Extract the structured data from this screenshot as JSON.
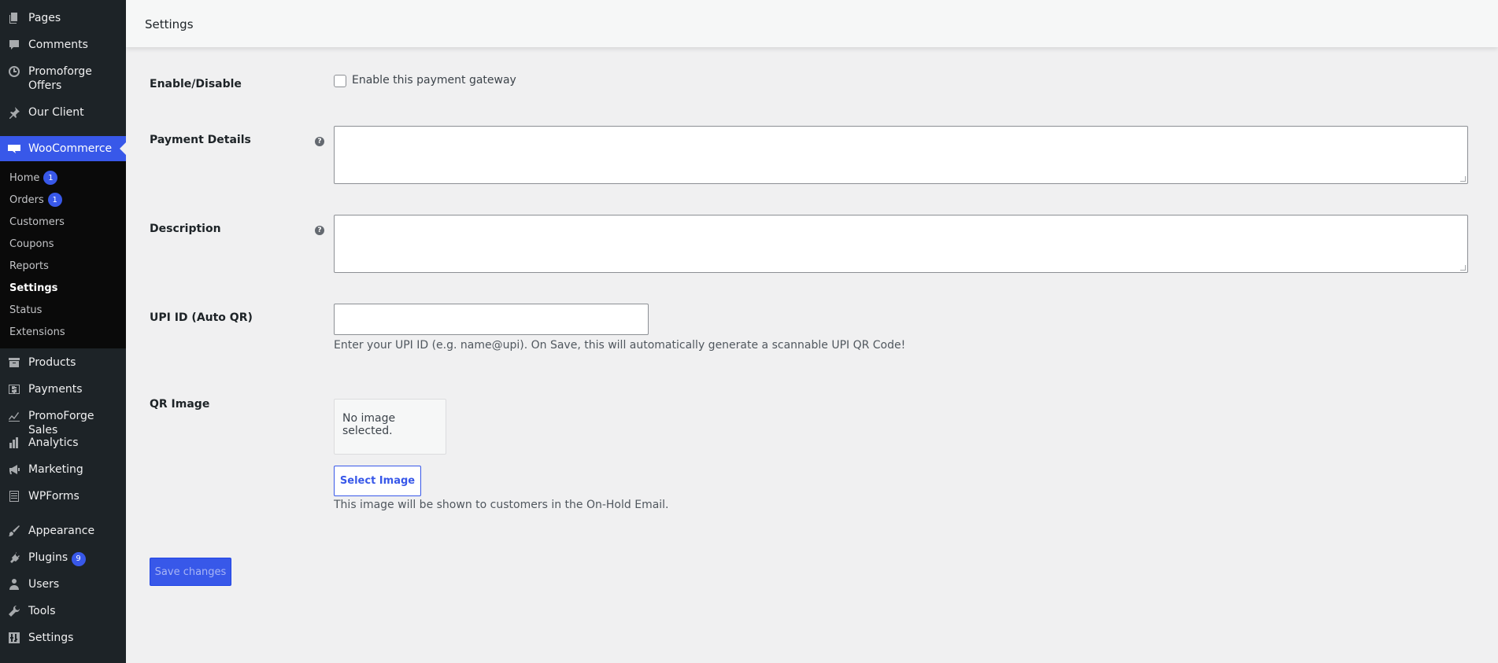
{
  "sidebar": {
    "items_top": [
      {
        "label": "Pages",
        "icon": "pages-icon"
      },
      {
        "label": "Comments",
        "icon": "comments-icon"
      },
      {
        "label": "Promoforge Offers",
        "icon": "clock-icon"
      },
      {
        "label": "Our Client",
        "icon": "pin-icon"
      }
    ],
    "woocommerce": "WooCommerce",
    "submenu": [
      {
        "label": "Home",
        "badge": "1"
      },
      {
        "label": "Orders",
        "badge": "1"
      },
      {
        "label": "Customers"
      },
      {
        "label": "Coupons"
      },
      {
        "label": "Reports"
      },
      {
        "label": "Settings"
      },
      {
        "label": "Status"
      },
      {
        "label": "Extensions"
      }
    ],
    "items_bottom": [
      {
        "label": "Products"
      },
      {
        "label": "Payments"
      },
      {
        "label": "PromoForge Sales"
      },
      {
        "label": "Analytics"
      },
      {
        "label": "Marketing"
      },
      {
        "label": "WPForms"
      },
      {
        "label": "Appearance"
      },
      {
        "label": "Plugins",
        "badge": "9"
      },
      {
        "label": "Users"
      },
      {
        "label": "Tools"
      },
      {
        "label": "Settings"
      }
    ]
  },
  "header": {
    "title": "Settings"
  },
  "form": {
    "enable_label": "Enable/Disable",
    "enable_checkbox_label": "Enable this payment gateway",
    "payment_details_label": "Payment Details",
    "payment_details_value": "",
    "description_label": "Description",
    "description_value": "",
    "upi_label": "UPI ID (Auto QR)",
    "upi_value": "",
    "upi_description": "Enter your UPI ID (e.g. name@upi). On Save, this will automatically generate a scannable UPI QR Code!",
    "qr_label": "QR Image",
    "qr_placeholder": "No image selected.",
    "select_image_label": "Select Image",
    "qr_description": "This image will be shown to customers in the On-Hold Email.",
    "save_label": "Save changes"
  },
  "colors": {
    "accent": "#3858e9",
    "sidebar": "#1d2327"
  }
}
